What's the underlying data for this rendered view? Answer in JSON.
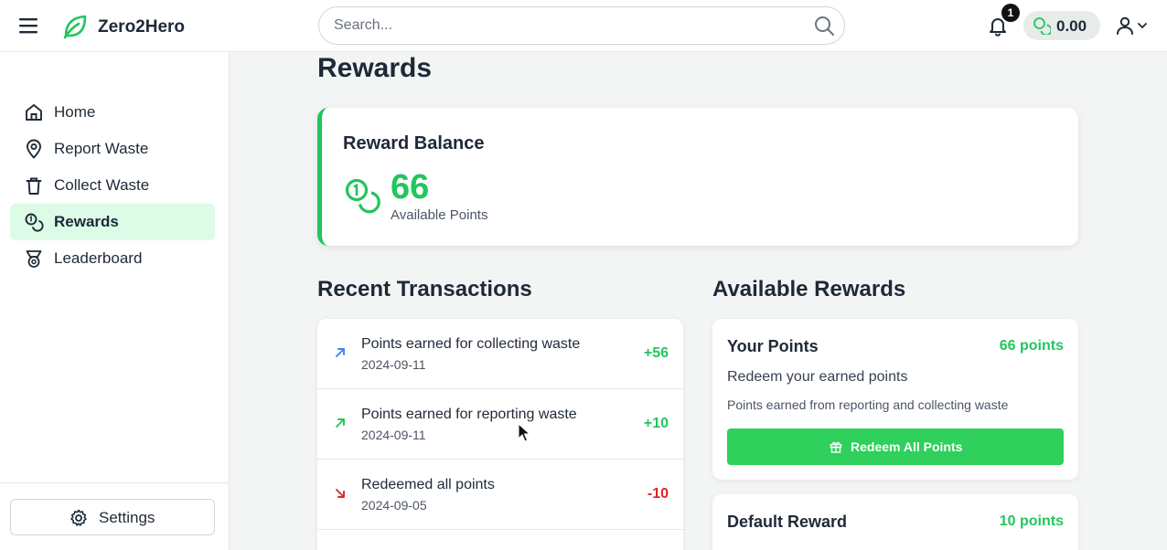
{
  "header": {
    "app_name": "Zero2Hero",
    "search_placeholder": "Search...",
    "notification_count": "1",
    "balance": "0.00"
  },
  "sidebar": {
    "items": [
      {
        "label": "Home",
        "icon": "home-icon"
      },
      {
        "label": "Report Waste",
        "icon": "map-pin-icon"
      },
      {
        "label": "Collect Waste",
        "icon": "trash-icon"
      },
      {
        "label": "Rewards",
        "icon": "coins-icon",
        "active": true
      },
      {
        "label": "Leaderboard",
        "icon": "medal-icon"
      }
    ],
    "settings_label": "Settings"
  },
  "main": {
    "title": "Rewards",
    "balance_card": {
      "title": "Reward Balance",
      "points": "66",
      "subtitle": "Available Points"
    },
    "transactions_title": "Recent Transactions",
    "transactions": [
      {
        "description": "Points earned for collecting waste",
        "date": "2024-09-11",
        "amount": "+56",
        "type": "earned"
      },
      {
        "description": "Points earned for reporting waste",
        "date": "2024-09-11",
        "amount": "+10",
        "type": "earned"
      },
      {
        "description": "Redeemed all points",
        "date": "2024-09-05",
        "amount": "-10",
        "type": "redeemed"
      }
    ],
    "rewards_title": "Available Rewards",
    "rewards": [
      {
        "name": "Your Points",
        "points": "66 points",
        "description": "Redeem your earned points",
        "info": "Points earned from reporting and collecting waste",
        "button_label": "Redeem All Points"
      },
      {
        "name": "Default Reward",
        "points": "10 points"
      }
    ]
  },
  "colors": {
    "accent": "#22c55e",
    "button": "#2fd05b",
    "negative": "#dc2626",
    "earned_arrow_blue": "#3b82f6",
    "active_nav_bg": "#dcfce7"
  }
}
